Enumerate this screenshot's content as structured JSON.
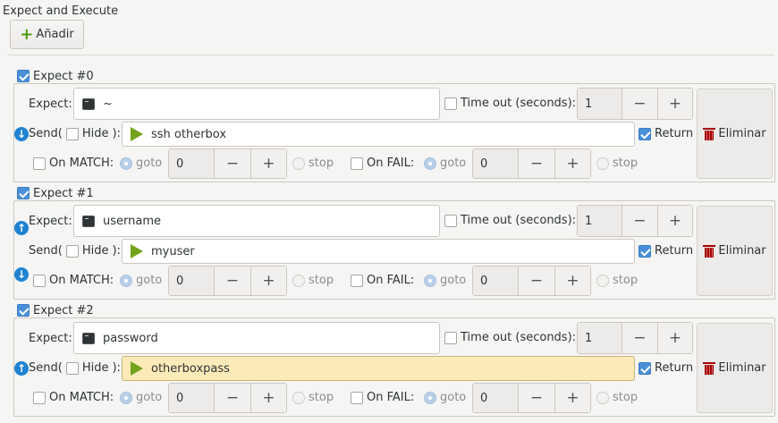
{
  "header": {
    "title": "Expect and Execute",
    "add_label": "Añadir"
  },
  "labels": {
    "expect": "Expect:",
    "send": "Send(",
    "hide": "Hide",
    "send_close": "):",
    "timeout": "Time out (seconds):",
    "return": "Return",
    "on_match": "On MATCH:",
    "on_fail": "On FAIL:",
    "goto": "goto",
    "stop": "stop",
    "delete": "Eliminar",
    "minus": "−",
    "plus": "+"
  },
  "expects": [
    {
      "title": "Expect #0",
      "expect_value": "~",
      "send_value": "ssh otherbox",
      "timeout": "1",
      "match_goto": "0",
      "fail_goto": "0",
      "hide_checked": false,
      "return_checked": true
    },
    {
      "title": "Expect #1",
      "expect_value": "username",
      "send_value": "myuser",
      "timeout": "1",
      "match_goto": "0",
      "fail_goto": "0",
      "hide_checked": false,
      "return_checked": true
    },
    {
      "title": "Expect #2",
      "expect_value": "password",
      "send_value": "otherboxpass",
      "timeout": "1",
      "match_goto": "0",
      "fail_goto": "0",
      "hide_checked": false,
      "return_checked": true
    }
  ]
}
